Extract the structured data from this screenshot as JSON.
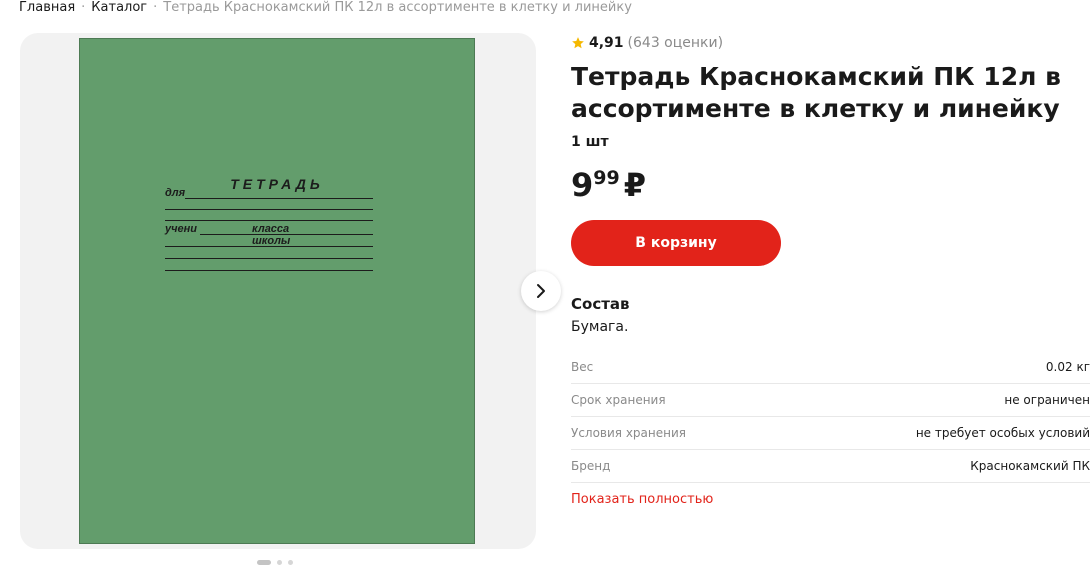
{
  "breadcrumb": {
    "items": [
      "Главная",
      "Каталог"
    ],
    "current": "Тетрадь Краснокамский ПК 12л в ассортименте в клетку и линейку"
  },
  "gallery": {
    "cover": {
      "title": "ТЕТРАДЬ",
      "line1_label": "для",
      "line3_label_a": "учени",
      "line3_label_b": "класса",
      "line4_label": "школы",
      "color": "#639d6c"
    },
    "next_icon": "chevron-right-icon",
    "slides_total": 3,
    "slide_active": 1
  },
  "product": {
    "rating": {
      "score": "4,91",
      "count": "(643 оценки)",
      "star_icon": "star-icon",
      "star_color": "#f5b800"
    },
    "title": "Тетрадь Краснокамский ПК 12л в ассортименте в клетку и линейку",
    "unit": "1 шт",
    "price": {
      "integer": "9",
      "fraction": "99",
      "currency": "₽"
    },
    "cart_button": "В корзину",
    "accent_color": "#e2231a",
    "composition_heading": "Состав",
    "composition_value": "Бумага.",
    "specs": [
      {
        "key": "Вес",
        "value": "0.02 кг"
      },
      {
        "key": "Срок хранения",
        "value": "не ограничен"
      },
      {
        "key": "Условия хранения",
        "value": "не требует особых условий"
      },
      {
        "key": "Бренд",
        "value": "Краснокамский ПК"
      }
    ],
    "show_more": "Показать полностью"
  }
}
